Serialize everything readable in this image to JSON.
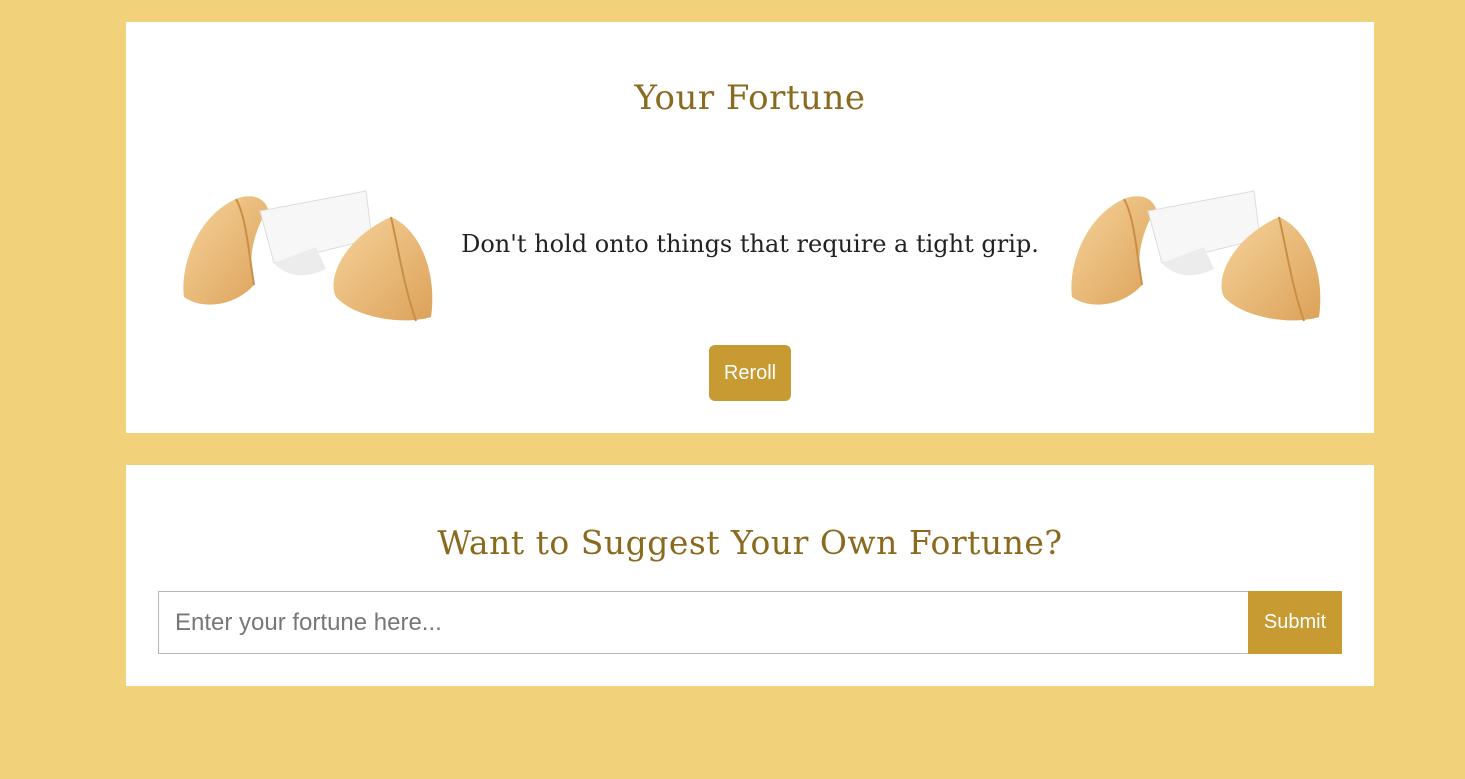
{
  "fortune": {
    "title": "Your Fortune",
    "text": "Don't hold onto things that require a tight grip.",
    "reroll_label": "Reroll",
    "image_left": "fortune-cookie-icon",
    "image_right": "fortune-cookie-icon"
  },
  "suggest": {
    "title": "Want to Suggest Your Own Fortune?",
    "input_placeholder": "Enter your fortune here...",
    "input_value": "",
    "submit_label": "Submit"
  },
  "colors": {
    "background": "#f1d17a",
    "card": "#ffffff",
    "accent": "#c89b32",
    "title_text": "#8a6a1f",
    "body_text": "#222222"
  }
}
